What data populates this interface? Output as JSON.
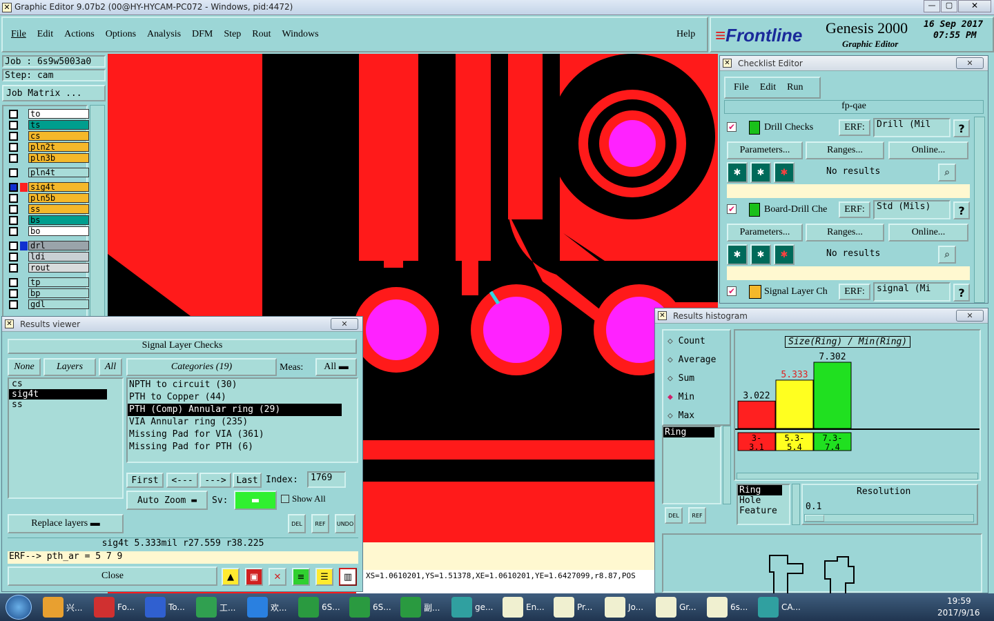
{
  "window": {
    "title": "Graphic Editor 9.07b2 (00@HY-HYCAM-PC072 - Windows, pid:4472)"
  },
  "menu": {
    "items": [
      "File",
      "Edit",
      "Actions",
      "Options",
      "Analysis",
      "DFM",
      "Step",
      "Rout",
      "Windows"
    ],
    "help": "Help"
  },
  "brand": {
    "logo": "Frontline",
    "product": "Genesis 2000",
    "subtitle": "Graphic Editor",
    "date": "16 Sep 2017",
    "time": "07:55 PM"
  },
  "job": {
    "job": "Job : 6s9w5003a0",
    "step": "Step: cam",
    "matrix": "Job Matrix ..."
  },
  "layers": [
    {
      "name": "to",
      "color": "#ffffff"
    },
    {
      "name": "ts",
      "color": "#009e8e"
    },
    {
      "name": "cs",
      "color": "#f5b82a"
    },
    {
      "name": "pln2t",
      "color": "#f5b82a"
    },
    {
      "name": "pln3b",
      "color": "#f5b82a"
    },
    {
      "name": "pln4t",
      "color": "#a8dcd8"
    },
    {
      "name": "sig4t",
      "color": "#f5b82a"
    },
    {
      "name": "pln5b",
      "color": "#f5b82a"
    },
    {
      "name": "ss",
      "color": "#f5b82a"
    },
    {
      "name": "bs",
      "color": "#009e8e"
    },
    {
      "name": "bo",
      "color": "#ffffff"
    },
    {
      "name": "drl",
      "color": "#9aa4aa"
    },
    {
      "name": "ldi",
      "color": "#c8d0d4"
    },
    {
      "name": "rout",
      "color": "#d8dcdc"
    },
    {
      "name": "tp",
      "color": "#a8dcd8"
    },
    {
      "name": "bp",
      "color": "#a8dcd8"
    },
    {
      "name": "gdl",
      "color": "#a8dcd8"
    }
  ],
  "checklist": {
    "title": "Checklist Editor",
    "menu": [
      "File",
      "Edit",
      "Run"
    ],
    "name": "fp-qae",
    "checks": [
      {
        "name": "Drill Checks",
        "erf": "ERF:",
        "erf_value": "Drill (Mil",
        "params": "Parameters...",
        "ranges": "Ranges...",
        "online": "Online...",
        "status": "No results"
      },
      {
        "name": "Board-Drill Che",
        "erf": "ERF:",
        "erf_value": "Std (Mils)",
        "params": "Parameters...",
        "ranges": "Ranges...",
        "online": "Online...",
        "status": "No results"
      },
      {
        "name": "Signal Layer Ch",
        "erf": "ERF:",
        "erf_value": "signal (Mi"
      }
    ]
  },
  "results": {
    "title": "Results viewer",
    "header": "Signal Layer Checks",
    "none": "None",
    "layers_btn": "Layers",
    "all": "All",
    "categories": "Categories (19)",
    "meas_label": "Meas:",
    "meas_value": "All",
    "layer_list": [
      "cs",
      "sig4t",
      "ss"
    ],
    "cat_list": [
      "NPTH to circuit (30)",
      "PTH to Copper (44)",
      "PTH (Comp) Annular ring (29)",
      "VIA Annular ring (235)",
      "Missing Pad for VIA (361)",
      "Missing Pad for PTH (6)"
    ],
    "nav": {
      "first": "First",
      "prev": "<---",
      "next": "--->",
      "last": "Last",
      "index_label": "Index:",
      "index_value": "1769"
    },
    "autozoom": "Auto Zoom",
    "sv": "Sv:",
    "showall": "Show All",
    "replace": "Replace layers",
    "status": "sig4t 5.333mil   r27.559   r38.225",
    "erf": "ERF--> pth_ar = 5 7 9",
    "close": "Close"
  },
  "histogram": {
    "title": "Results histogram",
    "modes": [
      "Count",
      "Average",
      "Sum",
      "Min",
      "Max"
    ],
    "selected_mode": "Min",
    "chart_title": "Size(Ring) / Min(Ring)",
    "list1": [
      "Ring"
    ],
    "list2": [
      "Ring",
      "Hole",
      "Feature"
    ],
    "resolution_label": "Resolution",
    "resolution_value": "0.1"
  },
  "chart_data": {
    "type": "bar",
    "title": "Size(Ring) / Min(Ring)",
    "categories": [
      "3-3.1",
      "5.3-5.4",
      "7.3-7.4"
    ],
    "bin_labels": [
      "3-\n3.1",
      "5.3-\n5.4",
      "7.3-\n7.4"
    ],
    "values": [
      3.022,
      5.333,
      7.302
    ],
    "value_labels": [
      "3.022",
      "5.333",
      "7.302"
    ],
    "colors": [
      "#ff2020",
      "#ffff20",
      "#20e020"
    ]
  },
  "coords": "XS=1.0610201,YS=1.51378,XE=1.0610201,YE=1.6427099,r8.87,POS",
  "taskbar": {
    "items": [
      "兴...",
      "Fo...",
      "To...",
      "工...",
      "欢...",
      "6S...",
      "6S...",
      "副...",
      "ge...",
      "En...",
      "Pr...",
      "Jo...",
      "Gr...",
      "6s...",
      "CA..."
    ],
    "time": "19:59",
    "date": "2017/9/16"
  }
}
